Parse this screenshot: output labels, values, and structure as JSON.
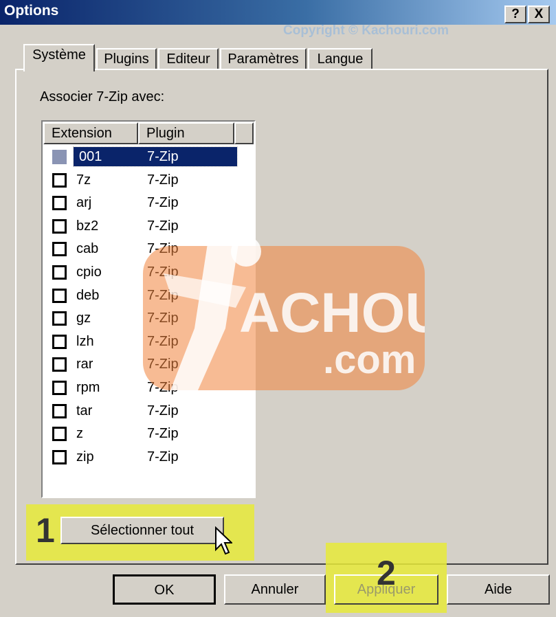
{
  "window": {
    "title": "Options",
    "watermark_copyright": "Copyright © Kachouri.com",
    "help_button": "?",
    "close_button": "X"
  },
  "tabs": [
    {
      "label": "Système",
      "active": true
    },
    {
      "label": "Plugins"
    },
    {
      "label": "Editeur"
    },
    {
      "label": "Paramètres"
    },
    {
      "label": "Langue"
    }
  ],
  "systeme": {
    "associate_label": "Associer 7-Zip avec:",
    "columns": [
      "Extension",
      "Plugin"
    ],
    "rows": [
      {
        "ext": "001",
        "plugin": "7-Zip",
        "selected": true
      },
      {
        "ext": "7z",
        "plugin": "7-Zip"
      },
      {
        "ext": "arj",
        "plugin": "7-Zip"
      },
      {
        "ext": "bz2",
        "plugin": "7-Zip"
      },
      {
        "ext": "cab",
        "plugin": "7-Zip"
      },
      {
        "ext": "cpio",
        "plugin": "7-Zip"
      },
      {
        "ext": "deb",
        "plugin": "7-Zip"
      },
      {
        "ext": "gz",
        "plugin": "7-Zip"
      },
      {
        "ext": "lzh",
        "plugin": "7-Zip"
      },
      {
        "ext": "rar",
        "plugin": "7-Zip"
      },
      {
        "ext": "rpm",
        "plugin": "7-Zip"
      },
      {
        "ext": "tar",
        "plugin": "7-Zip"
      },
      {
        "ext": "z",
        "plugin": "7-Zip"
      },
      {
        "ext": "zip",
        "plugin": "7-Zip"
      }
    ],
    "select_all_button": "Sélectionner tout"
  },
  "annotations": {
    "step1": "1",
    "step2": "2",
    "highlight_color": "#e6ea3a"
  },
  "footer": {
    "ok": "OK",
    "cancel": "Annuler",
    "apply": "Appliquer",
    "help": "Aide"
  },
  "watermark": {
    "logo_text": "ACHOURI",
    "logo_domain": ".com",
    "accent": "#f0843c"
  }
}
